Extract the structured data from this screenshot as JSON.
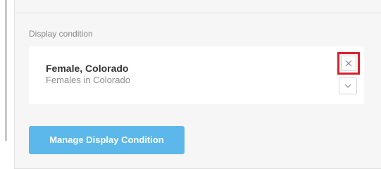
{
  "section": {
    "label": "Display condition"
  },
  "condition": {
    "name": "Female, Colorado",
    "description": "Females in Colorado",
    "remove_icon": "close-icon",
    "expand_icon": "chevron-down-icon"
  },
  "actions": {
    "manage_label": "Manage Display Condition"
  },
  "colors": {
    "accent": "#5cb8ea",
    "highlight": "#d8202c",
    "panel_background": "#f6f6f6"
  }
}
